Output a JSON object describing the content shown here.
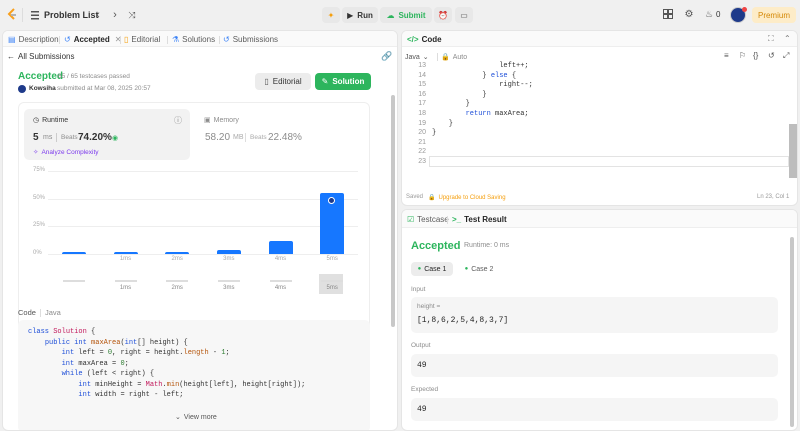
{
  "topbar": {
    "problem_list": "Problem List",
    "run": "Run",
    "submit": "Submit",
    "streak": "0",
    "premium": "Premium"
  },
  "left_tabs": {
    "description": "Description",
    "accepted": "Accepted",
    "editorial": "Editorial",
    "solutions": "Solutions",
    "submissions": "Submissions"
  },
  "result": {
    "back": "All Submissions",
    "status": "Accepted",
    "passed": "65 / 65 testcases passed",
    "user": "Kowsiha",
    "submitted": "submitted at Mar 08, 2025 20:57",
    "editorial_btn": "Editorial",
    "solution_btn": "Solution"
  },
  "runtime": {
    "label": "Runtime",
    "value": "5",
    "unit": "ms",
    "beats_label": "Beats",
    "beats": "74.20%",
    "analyze": "Analyze Complexity"
  },
  "memory": {
    "label": "Memory",
    "value": "58.20",
    "unit": "MB",
    "beats_label": "Beats",
    "beats": "22.48%"
  },
  "chart_data": {
    "type": "bar",
    "categories": [
      "",
      "1ms",
      "2ms",
      "3ms",
      "4ms",
      "5ms"
    ],
    "values": [
      1.5,
      1.5,
      1.5,
      4,
      12,
      55
    ],
    "highlight_index": 5,
    "ylim": [
      0,
      75
    ],
    "yticks": [
      "0%",
      "25%",
      "50%",
      "75%"
    ],
    "mini_labels": [
      "1ms",
      "2ms",
      "3ms",
      "4ms",
      "5ms"
    ]
  },
  "code_panel": {
    "code_label": "Code",
    "lang": "Java",
    "view_more": "View more",
    "lines": [
      "class Solution {",
      "    public int maxArea(int[] height) {",
      "        int left = 0, right = height.length - 1;",
      "        int maxArea = 0;",
      "",
      "        while (left < right) {",
      "            int minHeight = Math.min(height[left], height[right]);",
      "            int width = right - left;"
    ]
  },
  "editor": {
    "title": "Code",
    "lang": "Java",
    "mode": "Auto",
    "saved": "Saved",
    "upgrade": "Upgrade to Cloud Saving",
    "position": "Ln 23, Col 1",
    "line_numbers": [
      "13",
      "14",
      "15",
      "16",
      "17",
      "18",
      "19",
      "20",
      "21",
      "22",
      "23"
    ],
    "lines": [
      "                left++;",
      "            } else {",
      "                right--;",
      "            }",
      "        }",
      "        return maxArea;",
      "    }",
      "}",
      "",
      "",
      ""
    ]
  },
  "testpanel": {
    "testcase_tab": "Testcase",
    "result_tab": "Test Result",
    "status": "Accepted",
    "runtime": "Runtime: 0 ms",
    "case1": "Case 1",
    "case2": "Case 2",
    "input_label": "Input",
    "param": "height =",
    "input_value": "[1,8,6,2,5,4,8,3,7]",
    "output_label": "Output",
    "output_value": "49",
    "expected_label": "Expected",
    "expected_value": "49"
  }
}
